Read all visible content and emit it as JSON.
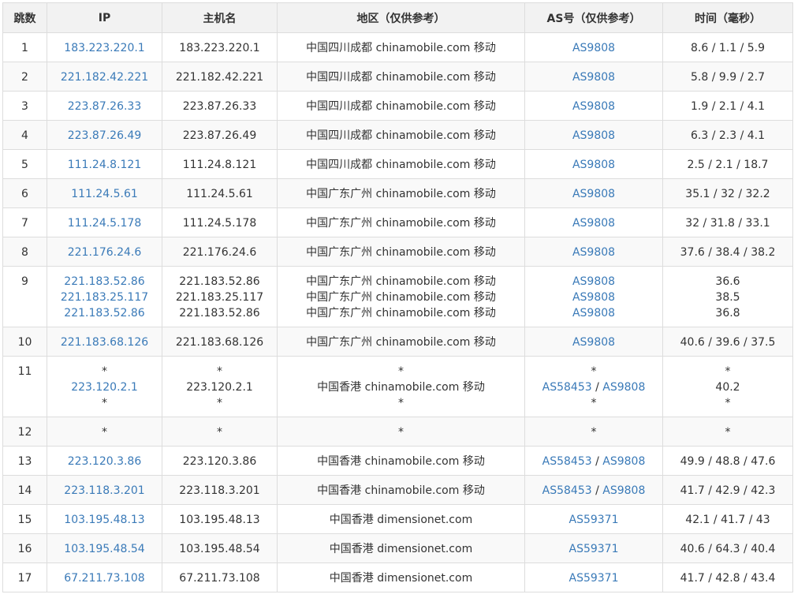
{
  "headers": [
    "跳数",
    "IP",
    "主机名",
    "地区（仅供参考）",
    "AS号（仅供参考）",
    "时间（毫秒）"
  ],
  "rows": [
    {
      "hop": "1",
      "lines": [
        {
          "ip": "183.223.220.1",
          "host": "183.223.220.1",
          "region": "中国四川成都 chinamobile.com 移动",
          "as": [
            "AS9808"
          ],
          "time": "8.6 / 1.1 / 5.9"
        }
      ]
    },
    {
      "hop": "2",
      "lines": [
        {
          "ip": "221.182.42.221",
          "host": "221.182.42.221",
          "region": "中国四川成都 chinamobile.com 移动",
          "as": [
            "AS9808"
          ],
          "time": "5.8 / 9.9 / 2.7"
        }
      ]
    },
    {
      "hop": "3",
      "lines": [
        {
          "ip": "223.87.26.33",
          "host": "223.87.26.33",
          "region": "中国四川成都 chinamobile.com 移动",
          "as": [
            "AS9808"
          ],
          "time": "1.9 / 2.1 / 4.1"
        }
      ]
    },
    {
      "hop": "4",
      "lines": [
        {
          "ip": "223.87.26.49",
          "host": "223.87.26.49",
          "region": "中国四川成都 chinamobile.com 移动",
          "as": [
            "AS9808"
          ],
          "time": "6.3 / 2.3 / 4.1"
        }
      ]
    },
    {
      "hop": "5",
      "lines": [
        {
          "ip": "111.24.8.121",
          "host": "111.24.8.121",
          "region": "中国四川成都 chinamobile.com 移动",
          "as": [
            "AS9808"
          ],
          "time": "2.5 / 2.1 / 18.7"
        }
      ]
    },
    {
      "hop": "6",
      "lines": [
        {
          "ip": "111.24.5.61",
          "host": "111.24.5.61",
          "region": "中国广东广州 chinamobile.com 移动",
          "as": [
            "AS9808"
          ],
          "time": "35.1 / 32 / 32.2"
        }
      ]
    },
    {
      "hop": "7",
      "lines": [
        {
          "ip": "111.24.5.178",
          "host": "111.24.5.178",
          "region": "中国广东广州 chinamobile.com 移动",
          "as": [
            "AS9808"
          ],
          "time": "32 / 31.8 / 33.1"
        }
      ]
    },
    {
      "hop": "8",
      "lines": [
        {
          "ip": "221.176.24.6",
          "host": "221.176.24.6",
          "region": "中国广东广州 chinamobile.com 移动",
          "as": [
            "AS9808"
          ],
          "time": "37.6 / 38.4 / 38.2"
        }
      ]
    },
    {
      "hop": "9",
      "lines": [
        {
          "ip": "221.183.52.86",
          "host": "221.183.52.86",
          "region": "中国广东广州 chinamobile.com 移动",
          "as": [
            "AS9808"
          ],
          "time": "36.6"
        },
        {
          "ip": "221.183.25.117",
          "host": "221.183.25.117",
          "region": "中国广东广州 chinamobile.com 移动",
          "as": [
            "AS9808"
          ],
          "time": "38.5"
        },
        {
          "ip": "221.183.52.86",
          "host": "221.183.52.86",
          "region": "中国广东广州 chinamobile.com 移动",
          "as": [
            "AS9808"
          ],
          "time": "36.8"
        }
      ]
    },
    {
      "hop": "10",
      "lines": [
        {
          "ip": "221.183.68.126",
          "host": "221.183.68.126",
          "region": "中国广东广州 chinamobile.com 移动",
          "as": [
            "AS9808"
          ],
          "time": "40.6 / 39.6 / 37.5"
        }
      ]
    },
    {
      "hop": "11",
      "lines": [
        {
          "ip": "*",
          "host": "*",
          "region": "*",
          "as": [
            "*"
          ],
          "time": "*"
        },
        {
          "ip": "223.120.2.1",
          "host": "223.120.2.1",
          "region": "中国香港 chinamobile.com 移动",
          "as": [
            "AS58453",
            "AS9808"
          ],
          "time": "40.2"
        },
        {
          "ip": "*",
          "host": "*",
          "region": "*",
          "as": [
            "*"
          ],
          "time": "*"
        }
      ]
    },
    {
      "hop": "12",
      "lines": [
        {
          "ip": "*",
          "host": "*",
          "region": "*",
          "as": [
            "*"
          ],
          "time": "*"
        }
      ]
    },
    {
      "hop": "13",
      "lines": [
        {
          "ip": "223.120.3.86",
          "host": "223.120.3.86",
          "region": "中国香港 chinamobile.com 移动",
          "as": [
            "AS58453",
            "AS9808"
          ],
          "time": "49.9 / 48.8 / 47.6"
        }
      ]
    },
    {
      "hop": "14",
      "lines": [
        {
          "ip": "223.118.3.201",
          "host": "223.118.3.201",
          "region": "中国香港 chinamobile.com 移动",
          "as": [
            "AS58453",
            "AS9808"
          ],
          "time": "41.7 / 42.9 / 42.3"
        }
      ]
    },
    {
      "hop": "15",
      "lines": [
        {
          "ip": "103.195.48.13",
          "host": "103.195.48.13",
          "region": "中国香港 dimensionet.com",
          "as": [
            "AS59371"
          ],
          "time": "42.1 / 41.7 / 43"
        }
      ]
    },
    {
      "hop": "16",
      "lines": [
        {
          "ip": "103.195.48.54",
          "host": "103.195.48.54",
          "region": "中国香港 dimensionet.com",
          "as": [
            "AS59371"
          ],
          "time": "40.6 / 64.3 / 40.4"
        }
      ]
    },
    {
      "hop": "17",
      "lines": [
        {
          "ip": "67.211.73.108",
          "host": "67.211.73.108",
          "region": "中国香港 dimensionet.com",
          "as": [
            "AS59371"
          ],
          "time": "41.7 / 42.8 / 43.4"
        }
      ]
    }
  ],
  "colors": {
    "link": "#3a7ab8",
    "header_bg": "#f2f2f2",
    "stripe_bg": "#f9f9f9",
    "border": "#dddddd"
  }
}
